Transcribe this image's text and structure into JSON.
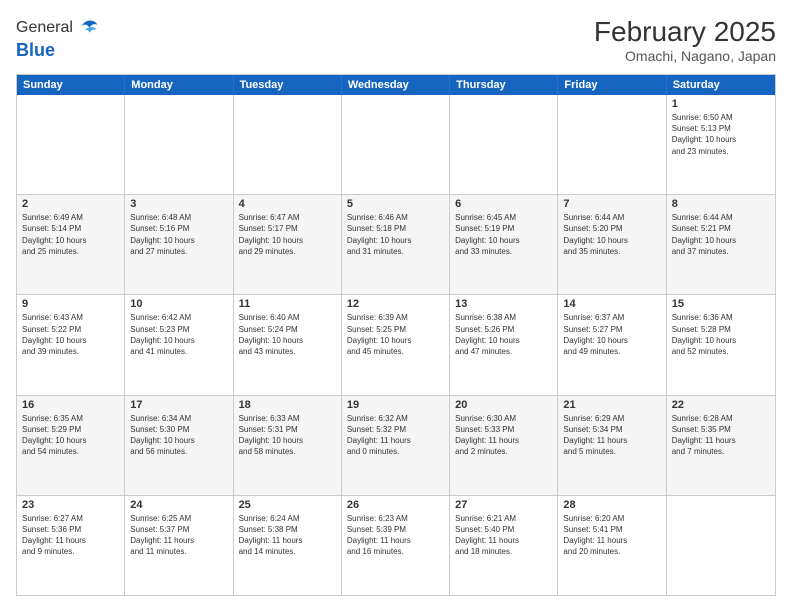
{
  "header": {
    "logo_general": "General",
    "logo_blue": "Blue",
    "month_title": "February 2025",
    "location": "Omachi, Nagano, Japan"
  },
  "calendar": {
    "days": [
      "Sunday",
      "Monday",
      "Tuesday",
      "Wednesday",
      "Thursday",
      "Friday",
      "Saturday"
    ],
    "rows": [
      [
        {
          "day": "",
          "info": ""
        },
        {
          "day": "",
          "info": ""
        },
        {
          "day": "",
          "info": ""
        },
        {
          "day": "",
          "info": ""
        },
        {
          "day": "",
          "info": ""
        },
        {
          "day": "",
          "info": ""
        },
        {
          "day": "1",
          "info": "Sunrise: 6:50 AM\nSunset: 5:13 PM\nDaylight: 10 hours\nand 23 minutes."
        }
      ],
      [
        {
          "day": "2",
          "info": "Sunrise: 6:49 AM\nSunset: 5:14 PM\nDaylight: 10 hours\nand 25 minutes."
        },
        {
          "day": "3",
          "info": "Sunrise: 6:48 AM\nSunset: 5:16 PM\nDaylight: 10 hours\nand 27 minutes."
        },
        {
          "day": "4",
          "info": "Sunrise: 6:47 AM\nSunset: 5:17 PM\nDaylight: 10 hours\nand 29 minutes."
        },
        {
          "day": "5",
          "info": "Sunrise: 6:46 AM\nSunset: 5:18 PM\nDaylight: 10 hours\nand 31 minutes."
        },
        {
          "day": "6",
          "info": "Sunrise: 6:45 AM\nSunset: 5:19 PM\nDaylight: 10 hours\nand 33 minutes."
        },
        {
          "day": "7",
          "info": "Sunrise: 6:44 AM\nSunset: 5:20 PM\nDaylight: 10 hours\nand 35 minutes."
        },
        {
          "day": "8",
          "info": "Sunrise: 6:44 AM\nSunset: 5:21 PM\nDaylight: 10 hours\nand 37 minutes."
        }
      ],
      [
        {
          "day": "9",
          "info": "Sunrise: 6:43 AM\nSunset: 5:22 PM\nDaylight: 10 hours\nand 39 minutes."
        },
        {
          "day": "10",
          "info": "Sunrise: 6:42 AM\nSunset: 5:23 PM\nDaylight: 10 hours\nand 41 minutes."
        },
        {
          "day": "11",
          "info": "Sunrise: 6:40 AM\nSunset: 5:24 PM\nDaylight: 10 hours\nand 43 minutes."
        },
        {
          "day": "12",
          "info": "Sunrise: 6:39 AM\nSunset: 5:25 PM\nDaylight: 10 hours\nand 45 minutes."
        },
        {
          "day": "13",
          "info": "Sunrise: 6:38 AM\nSunset: 5:26 PM\nDaylight: 10 hours\nand 47 minutes."
        },
        {
          "day": "14",
          "info": "Sunrise: 6:37 AM\nSunset: 5:27 PM\nDaylight: 10 hours\nand 49 minutes."
        },
        {
          "day": "15",
          "info": "Sunrise: 6:36 AM\nSunset: 5:28 PM\nDaylight: 10 hours\nand 52 minutes."
        }
      ],
      [
        {
          "day": "16",
          "info": "Sunrise: 6:35 AM\nSunset: 5:29 PM\nDaylight: 10 hours\nand 54 minutes."
        },
        {
          "day": "17",
          "info": "Sunrise: 6:34 AM\nSunset: 5:30 PM\nDaylight: 10 hours\nand 56 minutes."
        },
        {
          "day": "18",
          "info": "Sunrise: 6:33 AM\nSunset: 5:31 PM\nDaylight: 10 hours\nand 58 minutes."
        },
        {
          "day": "19",
          "info": "Sunrise: 6:32 AM\nSunset: 5:32 PM\nDaylight: 11 hours\nand 0 minutes."
        },
        {
          "day": "20",
          "info": "Sunrise: 6:30 AM\nSunset: 5:33 PM\nDaylight: 11 hours\nand 2 minutes."
        },
        {
          "day": "21",
          "info": "Sunrise: 6:29 AM\nSunset: 5:34 PM\nDaylight: 11 hours\nand 5 minutes."
        },
        {
          "day": "22",
          "info": "Sunrise: 6:28 AM\nSunset: 5:35 PM\nDaylight: 11 hours\nand 7 minutes."
        }
      ],
      [
        {
          "day": "23",
          "info": "Sunrise: 6:27 AM\nSunset: 5:36 PM\nDaylight: 11 hours\nand 9 minutes."
        },
        {
          "day": "24",
          "info": "Sunrise: 6:25 AM\nSunset: 5:37 PM\nDaylight: 11 hours\nand 11 minutes."
        },
        {
          "day": "25",
          "info": "Sunrise: 6:24 AM\nSunset: 5:38 PM\nDaylight: 11 hours\nand 14 minutes."
        },
        {
          "day": "26",
          "info": "Sunrise: 6:23 AM\nSunset: 5:39 PM\nDaylight: 11 hours\nand 16 minutes."
        },
        {
          "day": "27",
          "info": "Sunrise: 6:21 AM\nSunset: 5:40 PM\nDaylight: 11 hours\nand 18 minutes."
        },
        {
          "day": "28",
          "info": "Sunrise: 6:20 AM\nSunset: 5:41 PM\nDaylight: 11 hours\nand 20 minutes."
        },
        {
          "day": "",
          "info": ""
        }
      ]
    ]
  }
}
